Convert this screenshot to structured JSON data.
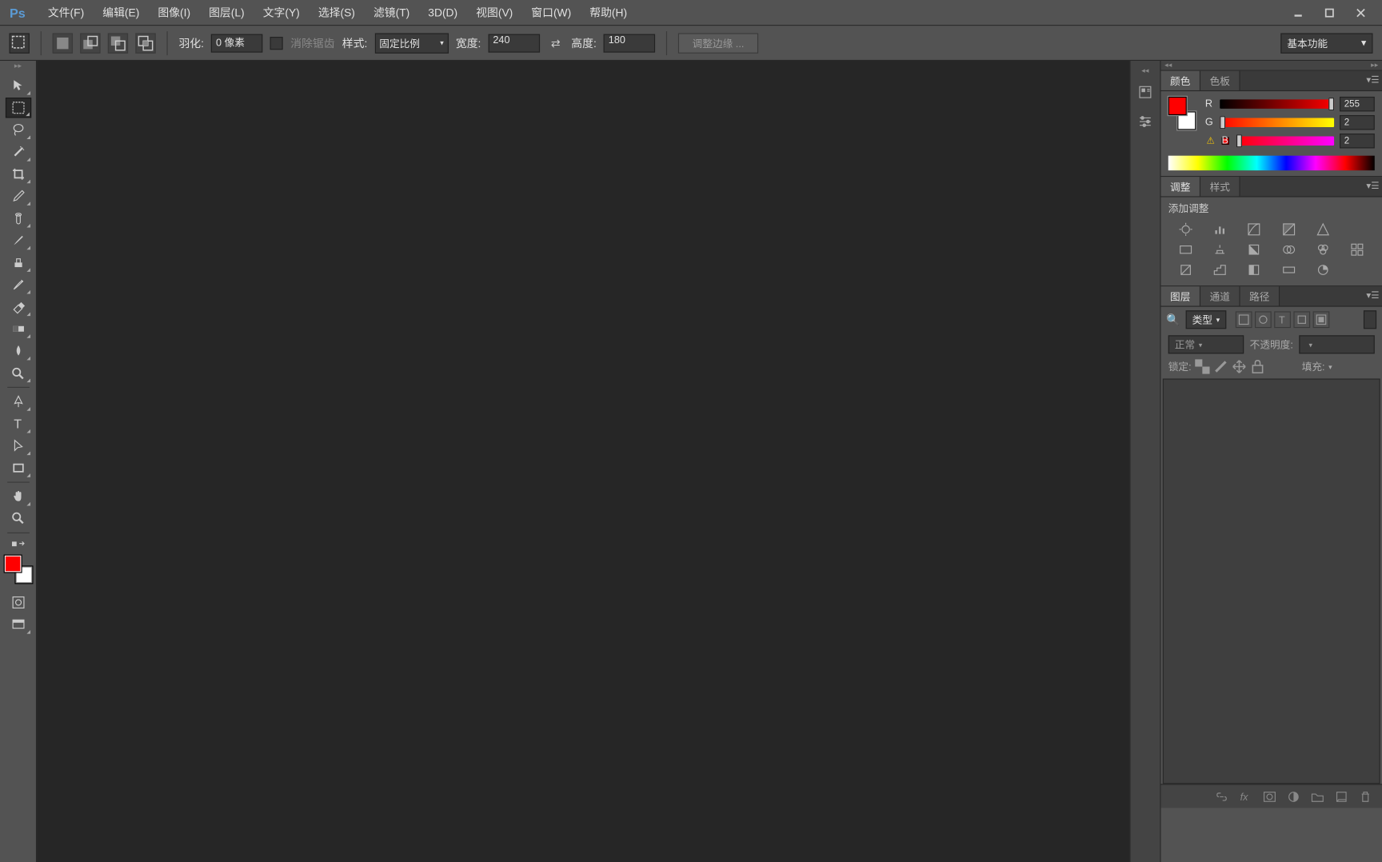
{
  "app_logo": "Ps",
  "menu": {
    "file": "文件(F)",
    "edit": "编辑(E)",
    "image": "图像(I)",
    "layer": "图层(L)",
    "type": "文字(Y)",
    "select": "选择(S)",
    "filter": "滤镜(T)",
    "threeD": "3D(D)",
    "view": "视图(V)",
    "window": "窗口(W)",
    "help": "帮助(H)"
  },
  "options": {
    "feather_label": "羽化:",
    "feather_value": "0 像素",
    "antialias_label": "消除锯齿",
    "style_label": "样式:",
    "style_value": "固定比例",
    "width_label": "宽度:",
    "width_value": "240",
    "height_label": "高度:",
    "height_value": "180",
    "refine_edge": "调整边缘 ...",
    "workspace": "基本功能"
  },
  "color_panel": {
    "tab_color": "颜色",
    "tab_swatches": "色板",
    "r_label": "R",
    "r_value": "255",
    "g_label": "G",
    "g_value": "2",
    "b_label": "B",
    "b_value": "2"
  },
  "adjust_panel": {
    "tab_adjust": "调整",
    "tab_styles": "样式",
    "add_adjust": "添加调整"
  },
  "layers_panel": {
    "tab_layers": "图层",
    "tab_channels": "通道",
    "tab_paths": "路径",
    "kind": "类型",
    "blend_mode": "正常",
    "opacity_label": "不透明度:",
    "lock_label": "锁定:",
    "fill_label": "填充:"
  }
}
